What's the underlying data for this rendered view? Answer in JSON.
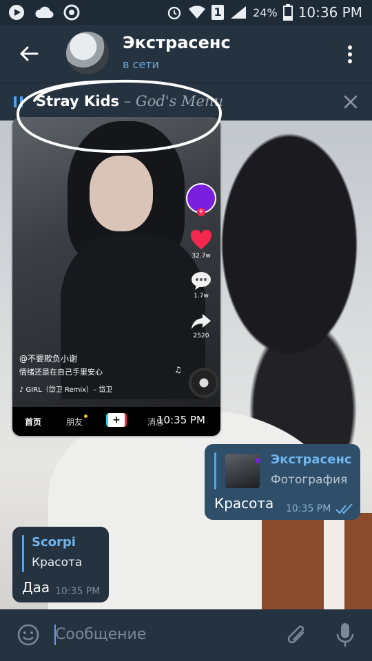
{
  "status_bar": {
    "battery": "24%",
    "time": "10:36 PM",
    "sim": "1"
  },
  "header": {
    "title": "Экстрасенс",
    "subtitle": "в сети"
  },
  "player": {
    "artist": "Stray Kids",
    "separator": " – ",
    "song": "God's Menu"
  },
  "photo": {
    "tiktok": {
      "likes": "32.7w",
      "comments": "1.7w",
      "shares": "2520",
      "username": "@不要欺负小谢",
      "caption": "情绪还是在自己手里安心",
      "music": "♪ GIRL（岱卫 Remix）– 岱卫",
      "nav": [
        "首页",
        "朋友",
        "+",
        "消息"
      ]
    },
    "time": "10:35 PM"
  },
  "messages": [
    {
      "direction": "out",
      "reply_to": {
        "name": "Экстрасенс",
        "text": "Фотография"
      },
      "text": "Красота",
      "time": "10:35 PM"
    },
    {
      "direction": "in",
      "reply_to": {
        "name": "Scorpi",
        "text": "Красота"
      },
      "text": "Даа",
      "time": "10:35 PM"
    }
  ],
  "composer": {
    "placeholder": "Сообщение"
  },
  "colors": {
    "header_bg": "#25323f",
    "accent": "#5aa4e6",
    "out_bubble": "#2e4e69",
    "in_bubble": "#25323f"
  }
}
